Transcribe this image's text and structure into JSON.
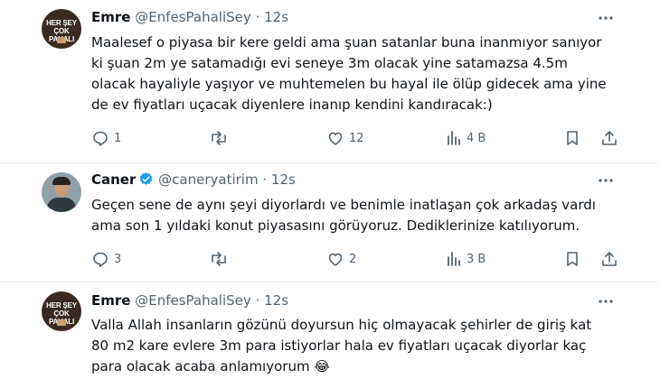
{
  "tweets": [
    {
      "name": "Emre",
      "handle": "@EnfesPahaliSey",
      "dot": "·",
      "time": "12s",
      "avatar_text": "HER ŞEY ÇOK PAHALI",
      "lines": [
        "Maalesef o piyasa bir kere geldi ama şuan satanlar buna inanmıyor sanıyor",
        "ki şuan 2m ye satamadığı evi seneye 3m olacak yine satamazsa 4.5m",
        "olacak hayaliyle yaşıyor ve muhtemelen bu hayal ile ölüp gidecek ama yine",
        "de ev fiyatları uçacak diyenlere inanıp kendini kandıracak:)"
      ],
      "replies": "1",
      "retweets": "",
      "likes": "12",
      "views": "4 B"
    },
    {
      "name": "Caner",
      "handle": "@caneryatirim",
      "dot": "·",
      "time": "12s",
      "verified": true,
      "lines": [
        "Geçen sene de aynı şeyi diyorlardı ve benimle inatlaşan çok arkadaş vardı",
        "ama son 1 yıldaki konut piyasasını görüyoruz. Dediklerinize katılıyorum."
      ],
      "replies": "3",
      "retweets": "",
      "likes": "2",
      "views": "3 B"
    },
    {
      "name": "Emre",
      "handle": "@EnfesPahaliSey",
      "dot": "·",
      "time": "12s",
      "avatar_text": "HER ŞEY ÇOK PAHALI",
      "lines": [
        "Valla Allah insanların gözünü doyursun hiç olmayacak şehirler de giriş kat",
        "80 m2 kare evlere 3m para istiyorlar hala ev fiyatları uçacak diyorlar kaç",
        "para olacak acaba anlamıyorum 😂"
      ]
    }
  ],
  "colors": {
    "text": "#0f1419",
    "secondary": "#536471",
    "divider": "#e6ecf0",
    "verified": "#1d9bf0"
  }
}
